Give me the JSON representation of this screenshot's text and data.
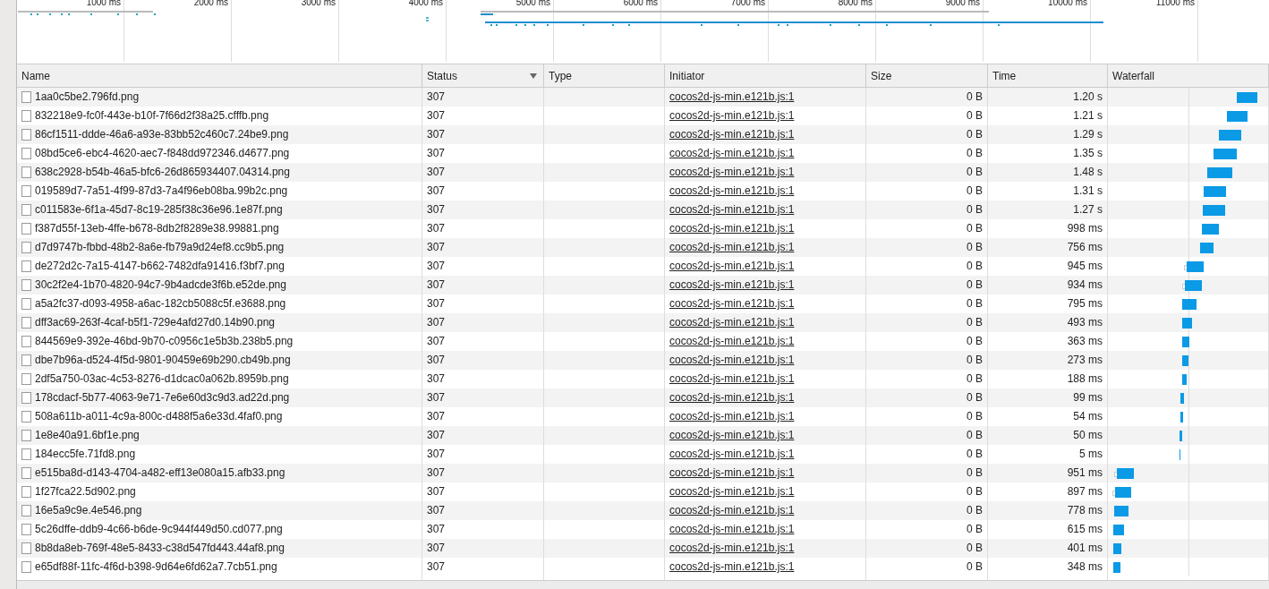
{
  "overview": {
    "ticks": [
      "1000 ms",
      "2000 ms",
      "3000 ms",
      "4000 ms",
      "5000 ms",
      "6000 ms",
      "7000 ms",
      "8000 ms",
      "9000 ms",
      "10000 ms",
      "11000 ms"
    ]
  },
  "table": {
    "columns": [
      {
        "label": "Name"
      },
      {
        "label": "Status",
        "sorted": true
      },
      {
        "label": "Type"
      },
      {
        "label": "Initiator"
      },
      {
        "label": "Size"
      },
      {
        "label": "Time"
      },
      {
        "label": "Waterfall"
      }
    ],
    "rows": [
      {
        "name": "1aa0c5be2.796fd.png",
        "status": "307",
        "initiator": "cocos2d-js-min.e121b.js:1",
        "size": "0 B",
        "time": "1.20 s"
      },
      {
        "name": "832218e9-fc0f-443e-b10f-7f66d2f38a25.cfffb.png",
        "status": "307",
        "initiator": "cocos2d-js-min.e121b.js:1",
        "size": "0 B",
        "time": "1.21 s"
      },
      {
        "name": "86cf1511-ddde-46a6-a93e-83bb52c460c7.24be9.png",
        "status": "307",
        "initiator": "cocos2d-js-min.e121b.js:1",
        "size": "0 B",
        "time": "1.29 s"
      },
      {
        "name": "08bd5ce6-ebc4-4620-aec7-f848dd972346.d4677.png",
        "status": "307",
        "initiator": "cocos2d-js-min.e121b.js:1",
        "size": "0 B",
        "time": "1.35 s"
      },
      {
        "name": "638c2928-b54b-46a5-bfc6-26d865934407.04314.png",
        "status": "307",
        "initiator": "cocos2d-js-min.e121b.js:1",
        "size": "0 B",
        "time": "1.48 s"
      },
      {
        "name": "019589d7-7a51-4f99-87d3-7a4f96eb08ba.99b2c.png",
        "status": "307",
        "initiator": "cocos2d-js-min.e121b.js:1",
        "size": "0 B",
        "time": "1.31 s"
      },
      {
        "name": "c011583e-6f1a-45d7-8c19-285f38c36e96.1e87f.png",
        "status": "307",
        "initiator": "cocos2d-js-min.e121b.js:1",
        "size": "0 B",
        "time": "1.27 s"
      },
      {
        "name": "f387d55f-13eb-4ffe-b678-8db2f8289e38.99881.png",
        "status": "307",
        "initiator": "cocos2d-js-min.e121b.js:1",
        "size": "0 B",
        "time": "998 ms"
      },
      {
        "name": "d7d9747b-fbbd-48b2-8a6e-fb79a9d24ef8.cc9b5.png",
        "status": "307",
        "initiator": "cocos2d-js-min.e121b.js:1",
        "size": "0 B",
        "time": "756 ms"
      },
      {
        "name": "de272d2c-7a15-4147-b662-7482dfa91416.f3bf7.png",
        "status": "307",
        "initiator": "cocos2d-js-min.e121b.js:1",
        "size": "0 B",
        "time": "945 ms"
      },
      {
        "name": "30c2f2e4-1b70-4820-94c7-9b4adcde3f6b.e52de.png",
        "status": "307",
        "initiator": "cocos2d-js-min.e121b.js:1",
        "size": "0 B",
        "time": "934 ms"
      },
      {
        "name": "a5a2fc37-d093-4958-a6ac-182cb5088c5f.e3688.png",
        "status": "307",
        "initiator": "cocos2d-js-min.e121b.js:1",
        "size": "0 B",
        "time": "795 ms"
      },
      {
        "name": "dff3ac69-263f-4caf-b5f1-729e4afd27d0.14b90.png",
        "status": "307",
        "initiator": "cocos2d-js-min.e121b.js:1",
        "size": "0 B",
        "time": "493 ms"
      },
      {
        "name": "844569e9-392e-46bd-9b70-c0956c1e5b3b.238b5.png",
        "status": "307",
        "initiator": "cocos2d-js-min.e121b.js:1",
        "size": "0 B",
        "time": "363 ms"
      },
      {
        "name": "dbe7b96a-d524-4f5d-9801-90459e69b290.cb49b.png",
        "status": "307",
        "initiator": "cocos2d-js-min.e121b.js:1",
        "size": "0 B",
        "time": "273 ms"
      },
      {
        "name": "2df5a750-03ac-4c53-8276-d1dcac0a062b.8959b.png",
        "status": "307",
        "initiator": "cocos2d-js-min.e121b.js:1",
        "size": "0 B",
        "time": "188 ms"
      },
      {
        "name": "178cdacf-5b77-4063-9e71-7e6e60d3c9d3.ad22d.png",
        "status": "307",
        "initiator": "cocos2d-js-min.e121b.js:1",
        "size": "0 B",
        "time": "99 ms"
      },
      {
        "name": "508a611b-a011-4c9a-800c-d488f5a6e33d.4faf0.png",
        "status": "307",
        "initiator": "cocos2d-js-min.e121b.js:1",
        "size": "0 B",
        "time": "54 ms"
      },
      {
        "name": "1e8e40a91.6bf1e.png",
        "status": "307",
        "initiator": "cocos2d-js-min.e121b.js:1",
        "size": "0 B",
        "time": "50 ms"
      },
      {
        "name": "184ecc5fe.71fd8.png",
        "status": "307",
        "initiator": "cocos2d-js-min.e121b.js:1",
        "size": "0 B",
        "time": "5 ms"
      },
      {
        "name": "e515ba8d-d143-4704-a482-eff13e080a15.afb33.png",
        "status": "307",
        "initiator": "cocos2d-js-min.e121b.js:1",
        "size": "0 B",
        "time": "951 ms"
      },
      {
        "name": "1f27fca22.5d902.png",
        "status": "307",
        "initiator": "cocos2d-js-min.e121b.js:1",
        "size": "0 B",
        "time": "897 ms"
      },
      {
        "name": "16e5a9c9e.4e546.png",
        "status": "307",
        "initiator": "cocos2d-js-min.e121b.js:1",
        "size": "0 B",
        "time": "778 ms"
      },
      {
        "name": "5c26dffe-ddb9-4c66-b6de-9c944f449d50.cd077.png",
        "status": "307",
        "initiator": "cocos2d-js-min.e121b.js:1",
        "size": "0 B",
        "time": "615 ms"
      },
      {
        "name": "8b8da8eb-769f-48e5-8433-c38d547fd443.44af8.png",
        "status": "307",
        "initiator": "cocos2d-js-min.e121b.js:1",
        "size": "0 B",
        "time": "401 ms"
      },
      {
        "name": "e65df88f-11fc-4f6d-b398-9d64e6fd62a7.7cb51.png",
        "status": "307",
        "initiator": "cocos2d-js-min.e121b.js:1",
        "size": "0 B",
        "time": "348 ms"
      }
    ]
  }
}
